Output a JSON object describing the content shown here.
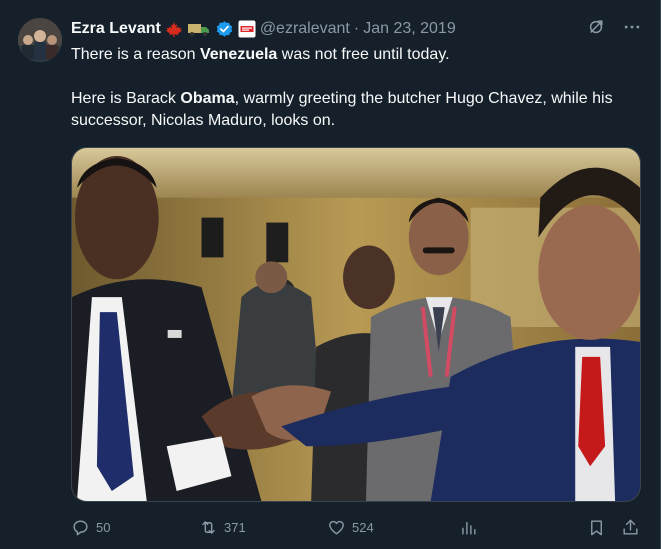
{
  "author": {
    "name": "Ezra Levant",
    "handle": "@ezralevant",
    "separator": "·",
    "date": "Jan 23, 2019",
    "badges": [
      "canada-flag-icon",
      "truck-icon",
      "verified-badge-icon",
      "rebel-news-logo"
    ]
  },
  "tweet": {
    "line1_pre": "There is a reason ",
    "line1_bold": "Venezuela",
    "line1_post": " was not free until today.",
    "line2_pre": "Here is Barack ",
    "line2_bold": "Obama",
    "line2_post": ", warmly greeting the butcher Hugo Chavez, while his successor, Nicolas Maduro, looks on."
  },
  "media": {
    "description_icon": "photo"
  },
  "actions": {
    "replies": "50",
    "retweets": "371",
    "likes": "524",
    "views": "",
    "icons": [
      "reply-icon",
      "retweet-icon",
      "like-icon",
      "views-icon",
      "bookmark-icon",
      "share-icon"
    ]
  },
  "colors": {
    "background": "#15202b",
    "text": "#f7f9f9",
    "muted": "#8b98a5",
    "verified": "#1d9bf0",
    "canada_red": "#d52b1e"
  }
}
